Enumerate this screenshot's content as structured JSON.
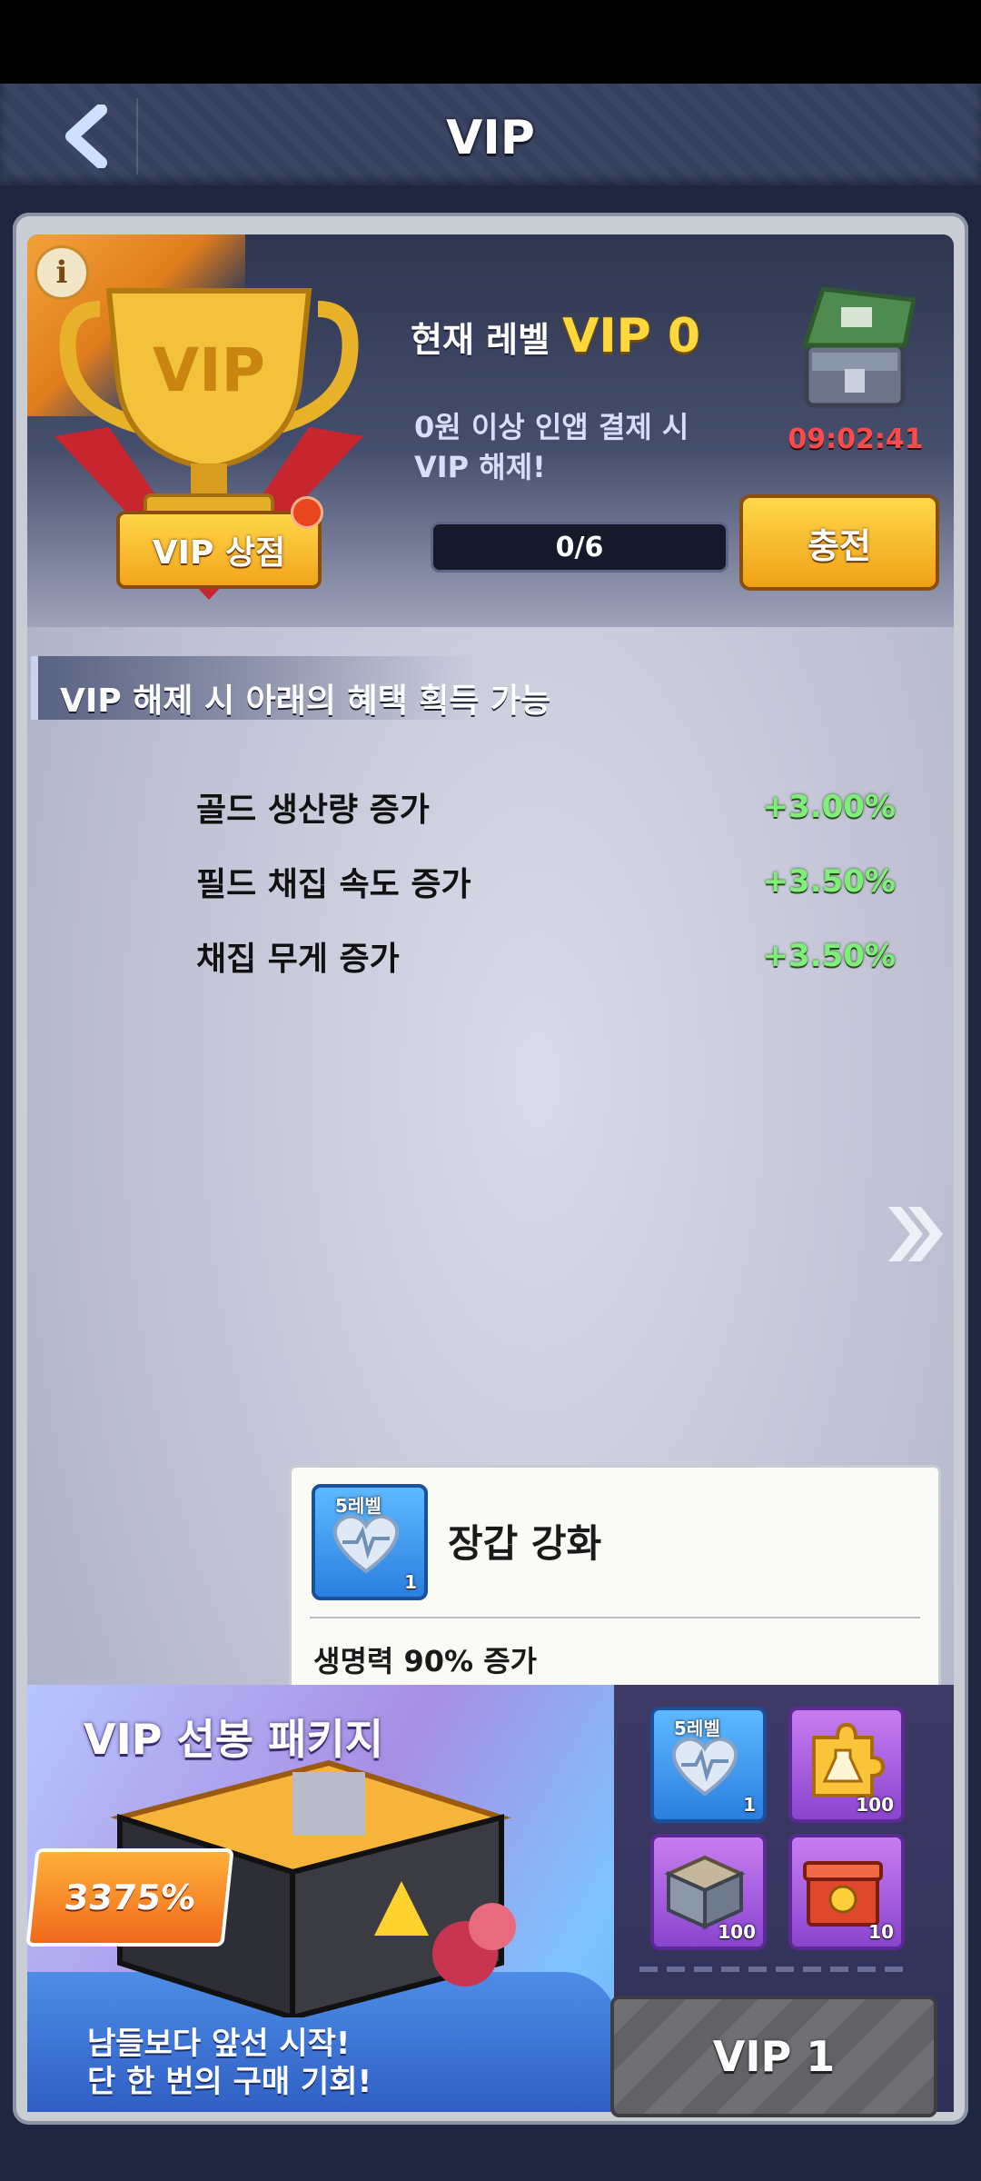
{
  "header": {
    "title": "VIP",
    "back_icon": "chevron-left-icon"
  },
  "vip_status": {
    "current_level_label": "현재 레벨",
    "current_level": "VIP 0",
    "unlock_desc_line1": "0원 이상 인앱 결제 시",
    "unlock_desc_line2": "VIP 해제!",
    "progress": "0/6",
    "progress_fraction": 0,
    "vip_shop_label": "VIP 상점",
    "charge_label": "충전",
    "timer": "09:02:41"
  },
  "benefits": {
    "title": "VIP 해제 시 아래의 혜택 획득 가능",
    "items": [
      {
        "name": "골드 생산량 증가",
        "value": "+3.00%"
      },
      {
        "name": "필드 채집 속도 증가",
        "value": "+3.50%"
      },
      {
        "name": "채집 무게 증가",
        "value": "+3.50%"
      }
    ]
  },
  "tooltip": {
    "level_badge": "5레벨",
    "count": "1",
    "name": "장갑 강화",
    "desc": "생명력 90% 증가"
  },
  "package": {
    "title": "VIP 선봉 패키지",
    "percent": "3375%",
    "desc_line1": "남들보다 앞선 시작!",
    "desc_line2": "단 한 번의 구매 기회!",
    "rewards": [
      {
        "label": "5레벨",
        "count": "1",
        "icon": "armor-heart-icon"
      },
      {
        "label": "",
        "count": "100",
        "icon": "puzzle-flask-icon"
      },
      {
        "label": "",
        "count": "100",
        "icon": "supply-crate-icon"
      },
      {
        "label": "",
        "count": "10",
        "icon": "red-gift-box-icon"
      }
    ],
    "button_label": "VIP 1"
  },
  "colors": {
    "accent_gold": "#ffd93b",
    "benefit_green": "#7ef07a",
    "timer_red": "#ff4a4a"
  }
}
